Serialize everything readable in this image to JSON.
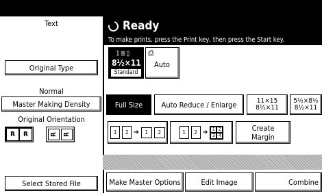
{
  "status": {
    "title": "Ready",
    "message": "To make prints, press the Print key, then press the Start key."
  },
  "left_panel": {
    "mode_label": "Text",
    "original_type_button": "Original Type",
    "density_value": "Normal",
    "density_button": "Master Making Density",
    "orientation_label": "Original Orientation",
    "stored_file_button": "Select Stored File"
  },
  "paper": {
    "size": "8½×11",
    "type": "Standard",
    "auto_label": "Auto"
  },
  "reduce_enlarge": {
    "full_size": "Full Size",
    "auto_reduce": "Auto Reduce / Enlarge",
    "ratio1_top": "11×15",
    "ratio1_bottom": "8½×11",
    "ratio2_top": "5½×8½",
    "ratio2_bottom": "8½×11"
  },
  "combine_opts": {
    "two_in_one_pages": [
      "1",
      "2",
      "1",
      "2"
    ],
    "four_in_one_pages": [
      "1",
      "2",
      "1",
      "2",
      "3",
      "4"
    ],
    "create_margin_line1": "Create",
    "create_margin_line2": "Margin"
  },
  "bottom_tabs": {
    "make_master": "Make Master Options",
    "edit_image": "Edit Image",
    "combine": "Combine"
  },
  "colors": {
    "background": "#ffffff",
    "dark": "#000000",
    "shadow": "#888888"
  }
}
